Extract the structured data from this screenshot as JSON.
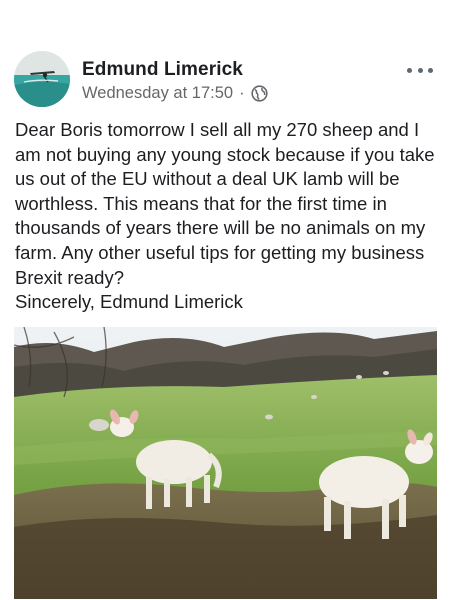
{
  "post": {
    "author": "Edmund Limerick",
    "timestamp": "Wednesday at 17:50",
    "separator": "·",
    "privacy_icon": "globe-icon",
    "more_icon": "more-options-icon",
    "text": "Dear Boris tomorrow I sell all my 270 sheep and I am not buying any young stock because if you take us out of the EU without a deal UK lamb will be worthless.  This means that for the first time in thousands of years there will be no animals on my farm.  Any other useful tips for getting my business Brexit ready?\nSincerely, Edmund Limerick",
    "image_description_icon": "lambs-photo"
  },
  "colors": {
    "name": "#1c1e21",
    "meta": "#65676b",
    "background": "#ffffff"
  }
}
